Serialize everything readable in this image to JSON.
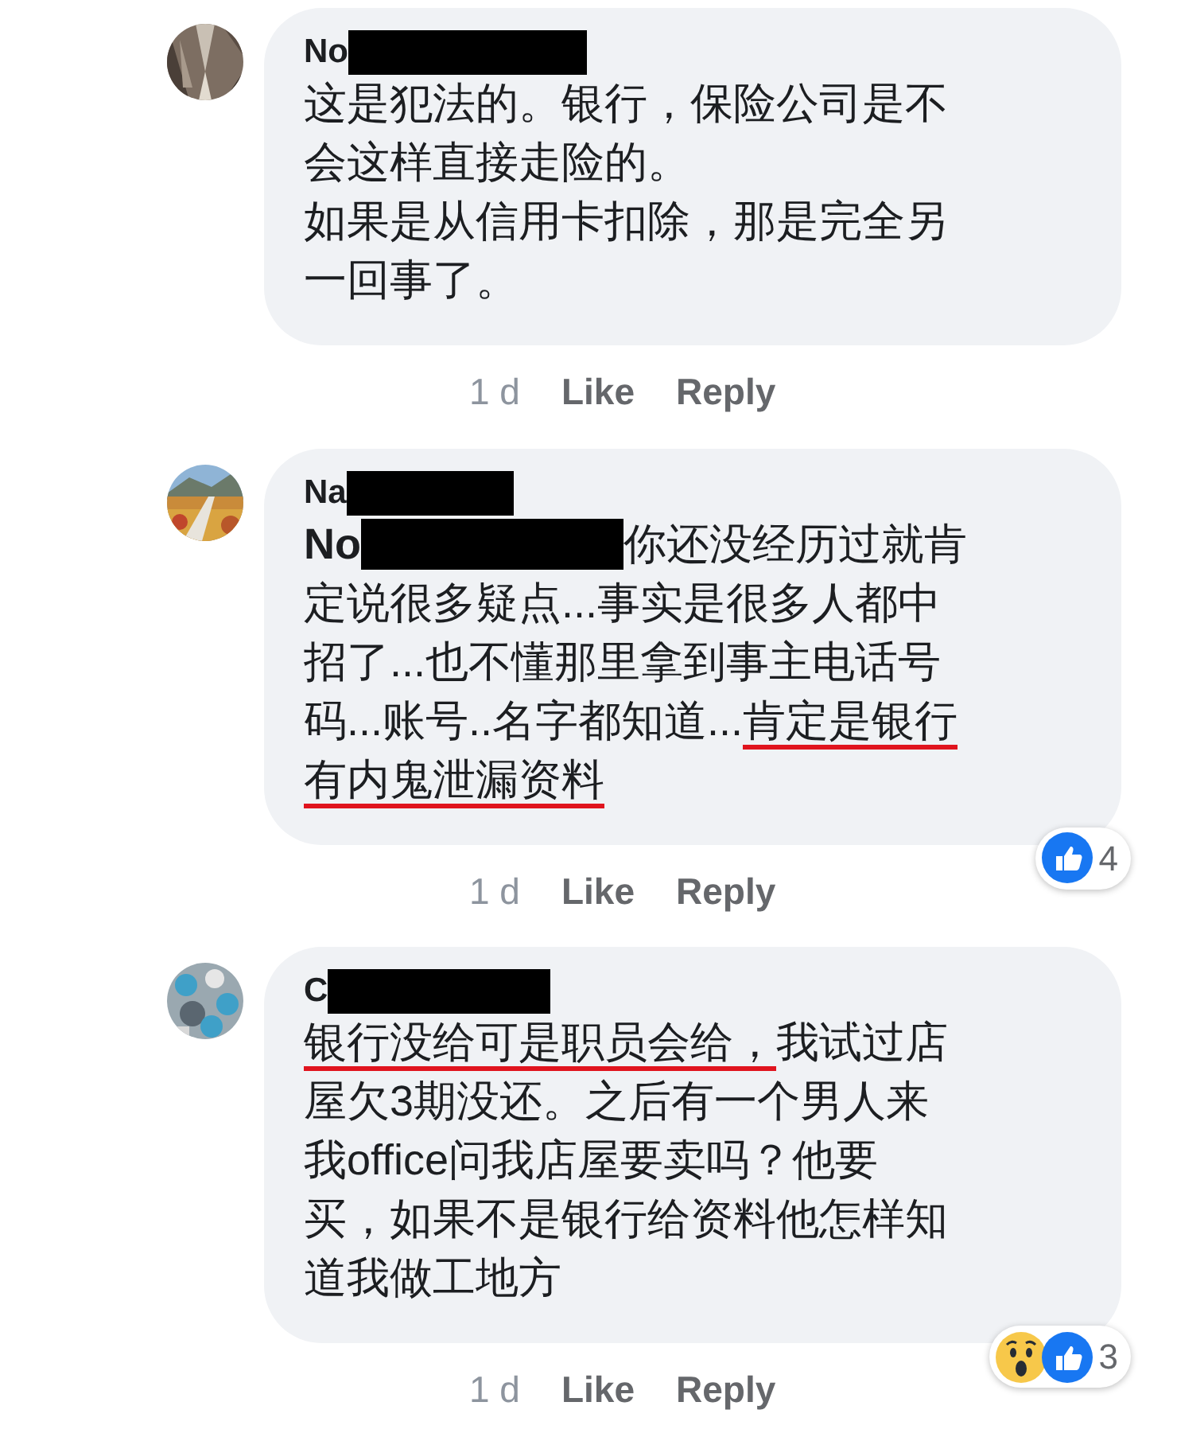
{
  "comments": [
    {
      "author": {
        "text": "No",
        "redacted": true
      },
      "avatar": {
        "kind": "picture"
      },
      "lines": [
        [
          {
            "text": "这是犯法的。银行，保险公司是不",
            "underlined": false
          }
        ],
        [
          {
            "text": "会这样直接走险的。",
            "underlined": false
          }
        ],
        [
          {
            "text": "如果是从信用卡扣除，那是完全另",
            "underlined": false
          }
        ],
        [
          {
            "text": "一回事了。",
            "underlined": false
          }
        ]
      ],
      "time": "1 d",
      "actions": [
        "Like",
        "Reply"
      ]
    },
    {
      "author": {
        "text": "Na",
        "redacted": true
      },
      "avatar": {
        "kind": "picture"
      },
      "mention": {
        "text": "No",
        "redacted": true
      },
      "lines": [
        [
          {
            "text": "你还没经历过就肯",
            "underlined": false
          }
        ],
        [
          {
            "text": "定说很多疑点...事实是很多人都中",
            "underlined": false
          }
        ],
        [
          {
            "text": "招了...也不懂那里拿到事主电话号",
            "underlined": false
          }
        ],
        [
          {
            "text": "码...账号..名字都知道...",
            "underlined": false
          },
          {
            "text": "肯定是银行",
            "underlined": true
          }
        ],
        [
          {
            "text": "有内鬼泄漏资料",
            "underlined": true
          }
        ]
      ],
      "time": "1 d",
      "actions": [
        "Like",
        "Reply"
      ],
      "reactions": [
        {
          "kind": "like"
        }
      ],
      "reaction_count": "4"
    },
    {
      "author": {
        "text": "C",
        "redacted": true
      },
      "avatar": {
        "kind": "picture"
      },
      "lines": [
        [
          {
            "text": "银行没给可是职员会给，",
            "underlined": true
          },
          {
            "text": "我试过店",
            "underlined": false
          }
        ],
        [
          {
            "text": "屋欠3期没还。之后有一个男人来",
            "underlined": false
          }
        ],
        [
          {
            "text": "我office问我店屋要卖吗？他要",
            "underlined": false
          }
        ],
        [
          {
            "text": "买，如果不是银行给资料他怎样知",
            "underlined": false
          }
        ],
        [
          {
            "text": "道我做工地方",
            "underlined": false
          }
        ]
      ],
      "time": "1 d",
      "actions": [
        "Like",
        "Reply"
      ],
      "reactions": [
        {
          "kind": "wow"
        },
        {
          "kind": "like"
        }
      ],
      "reaction_count": "3"
    }
  ]
}
